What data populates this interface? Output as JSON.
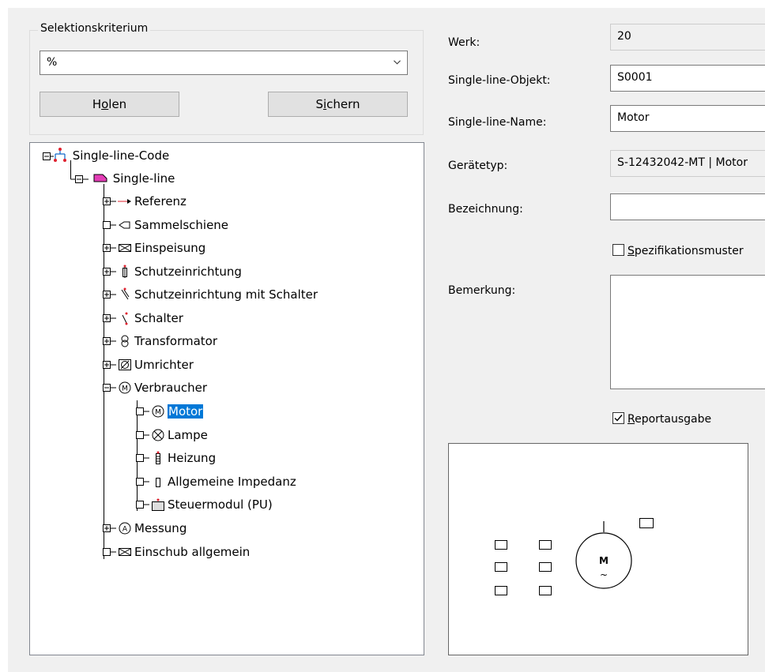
{
  "selection": {
    "legend": "Selektionskriterium",
    "combo_value": "%",
    "holen_label": "Holen",
    "sichern_label": "Sichern"
  },
  "tree": {
    "nodes": [
      {
        "label": "Single-line-Code",
        "icon": "code-icon"
      },
      {
        "label": "Single-line",
        "icon": "single-line-icon"
      },
      {
        "label": "Referenz",
        "icon": "reference-arrow-icon"
      },
      {
        "label": "Sammelschiene",
        "icon": "busbar-icon"
      },
      {
        "label": "Einspeisung",
        "icon": "feed-icon"
      },
      {
        "label": "Schutzeinrichtung",
        "icon": "fuse-icon"
      },
      {
        "label": "Schutzeinrichtung mit Schalter",
        "icon": "fuse-switch-icon"
      },
      {
        "label": "Schalter",
        "icon": "switch-icon"
      },
      {
        "label": "Transformator",
        "icon": "transformer-icon"
      },
      {
        "label": "Umrichter",
        "icon": "converter-icon"
      },
      {
        "label": "Verbraucher",
        "icon": "consumer-icon"
      },
      {
        "label": "Motor",
        "icon": "motor-icon"
      },
      {
        "label": "Lampe",
        "icon": "lamp-icon"
      },
      {
        "label": "Heizung",
        "icon": "heater-icon"
      },
      {
        "label": "Allgemeine Impedanz",
        "icon": "impedance-icon"
      },
      {
        "label": "Steuermodul (PU)",
        "icon": "control-module-icon"
      },
      {
        "label": "Messung",
        "icon": "measurement-icon"
      },
      {
        "label": "Einschub allgemein",
        "icon": "drawer-icon"
      }
    ],
    "selected": "Motor"
  },
  "form": {
    "werk_label": "Werk:",
    "werk_value": "20",
    "objekt_label": "Single-line-Objekt:",
    "objekt_value": "S0001",
    "name_label": "Single-line-Name:",
    "name_value": "Motor",
    "geraetetyp_label": "Gerätetyp:",
    "geraetetyp_value": "S-12432042-MT | Motor",
    "bezeichnung_label": "Bezeichnung:",
    "bezeichnung_value": "",
    "spezifikation_label": "Spezifikationsmuster",
    "spezifikation_checked": false,
    "bemerkung_label": "Bemerkung:",
    "bemerkung_value": "",
    "report_label": "Reportausgabe",
    "report_checked": true
  },
  "preview": {
    "motor_letter": "M",
    "motor_symbol": "~"
  }
}
